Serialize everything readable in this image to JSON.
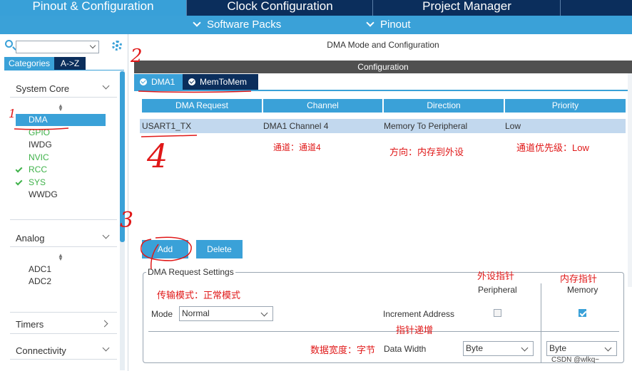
{
  "top_tabs": [
    "Pinout & Configuration",
    "Clock Configuration",
    "Project Manager"
  ],
  "sub_bar": {
    "software_packs": "Software Packs",
    "pinout": "Pinout"
  },
  "left": {
    "category_tabs": [
      "Categories",
      "A->Z"
    ],
    "sections": {
      "system_core": "System Core",
      "analog": "Analog",
      "timers": "Timers",
      "connectivity": "Connectivity"
    },
    "system_core_items": [
      {
        "label": "DMA",
        "state": "selected"
      },
      {
        "label": "GPIO",
        "state": "green"
      },
      {
        "label": "IWDG",
        "state": "normal"
      },
      {
        "label": "NVIC",
        "state": "green"
      },
      {
        "label": "RCC",
        "state": "checked"
      },
      {
        "label": "SYS",
        "state": "checked"
      },
      {
        "label": "WWDG",
        "state": "normal"
      }
    ],
    "analog_items": [
      "ADC1",
      "ADC2"
    ]
  },
  "main": {
    "mode_header": "DMA Mode and Configuration",
    "configuration_bar": "Configuration",
    "tabs": [
      "DMA1",
      "MemToMem"
    ],
    "table": {
      "headers": [
        "DMA Request",
        "Channel",
        "Direction",
        "Priority"
      ],
      "rows": [
        [
          "USART1_TX",
          "DMA1 Channel 4",
          "Memory To Peripheral",
          "Low"
        ]
      ]
    },
    "buttons": {
      "add": "Add",
      "delete": "Delete"
    },
    "settings": {
      "title": "DMA Request Settings",
      "mode_label": "Mode",
      "mode_value": "Normal",
      "peripheral_label": "Peripheral",
      "memory_label": "Memory",
      "increment_label": "Increment Address",
      "increment_peripheral": false,
      "increment_memory": true,
      "data_width_label": "Data Width",
      "peripheral_width": "Byte",
      "memory_width": "Byte"
    }
  },
  "annotations": {
    "channel": "通道：通道4",
    "direction": "方向：内存到外设",
    "priority": "通道优先级：Low",
    "transfer_mode": "传输模式：正常模式",
    "peripheral_pointer": "外设指针",
    "memory_pointer": "内存指针",
    "pointer_increment": "指针递增",
    "data_width": "数据宽度：字节",
    "num1": "1",
    "num2": "2",
    "num3": "3",
    "num4": "4"
  },
  "watermark": "CSDN @wlkq~",
  "colors": {
    "accent": "#3aa1d8",
    "navy": "#0b2e5c",
    "annotation": "#e01818",
    "enabled_green": "#3fb24a"
  }
}
